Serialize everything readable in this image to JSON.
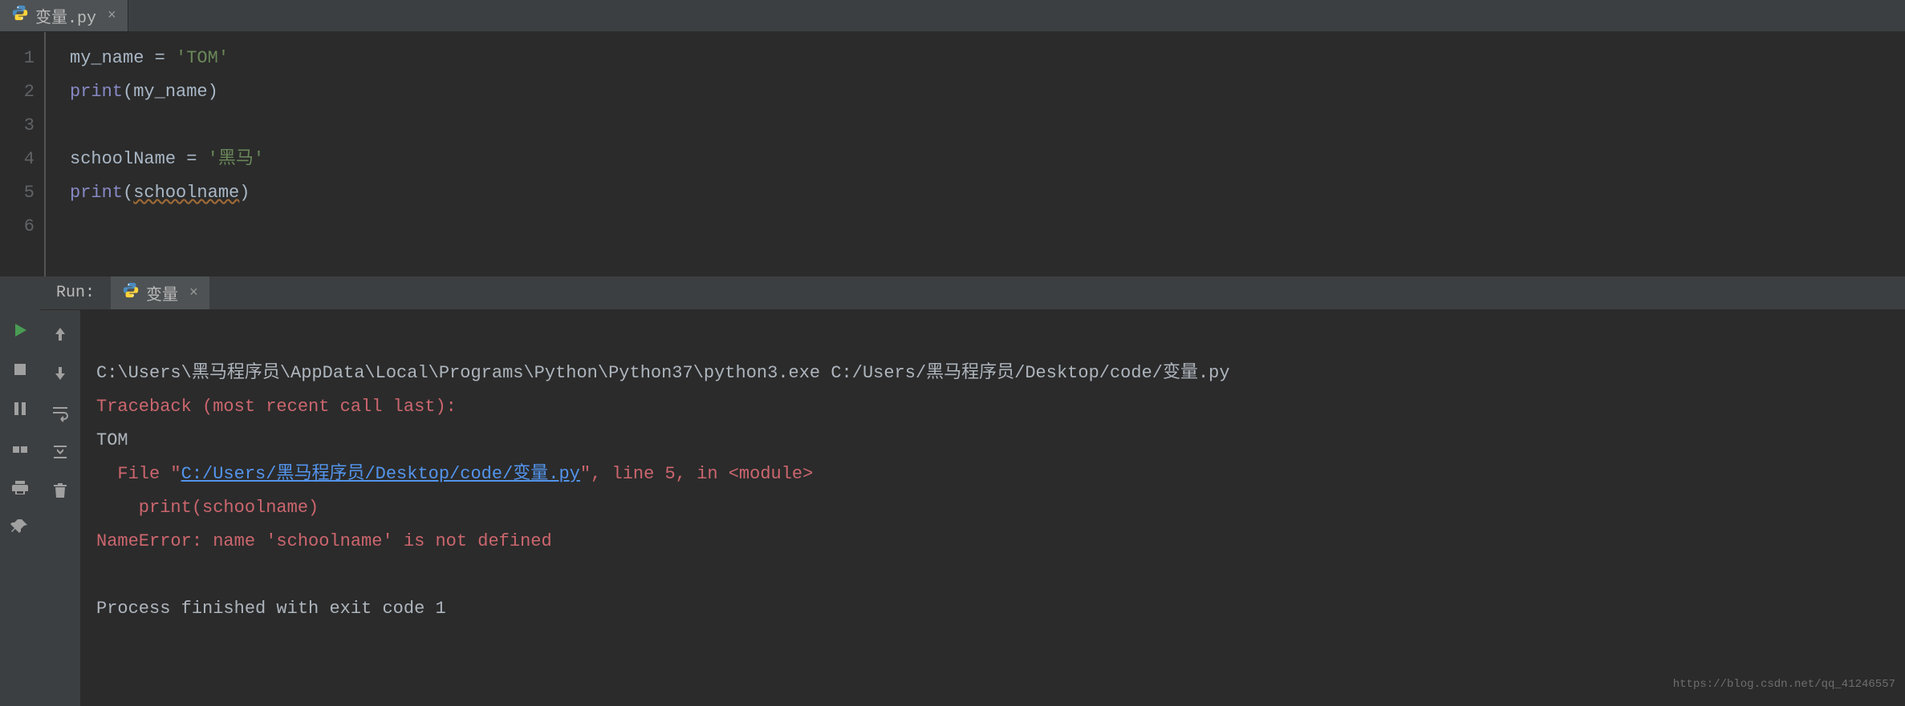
{
  "editor": {
    "tab": {
      "filename": "变量.py",
      "icon": "python-file-icon"
    },
    "lines": [
      "1",
      "2",
      "3",
      "4",
      "5",
      "6"
    ],
    "code": {
      "l1_var": "my_name",
      "l1_eq": " = ",
      "l1_str": "'TOM'",
      "l2_fn": "print",
      "l2_open": "(",
      "l2_arg": "my_name",
      "l2_close": ")",
      "l4_var": "schoolName",
      "l4_eq": " = ",
      "l4_str": "'黑马'",
      "l5_fn": "print",
      "l5_open": "(",
      "l5_arg": "schoolname",
      "l5_close": ")"
    }
  },
  "run": {
    "label": "Run:",
    "tab_name": "变量",
    "output": {
      "cmd": "C:\\Users\\黑马程序员\\AppData\\Local\\Programs\\Python\\Python37\\python3.exe C:/Users/黑马程序员/Desktop/code/变量.py",
      "traceback_head": "Traceback (most recent call last):",
      "stdout1": "TOM",
      "file_prefix": "  File \"",
      "file_link": "C:/Users/黑马程序员/Desktop/code/变量.py",
      "file_suffix": "\", line 5, in <module>",
      "code_echo": "    print(schoolname)",
      "err_msg": "NameError: name 'schoolname' is not defined",
      "finish": "Process finished with exit code 1"
    }
  },
  "watermark": "https://blog.csdn.net/qq_41246557"
}
